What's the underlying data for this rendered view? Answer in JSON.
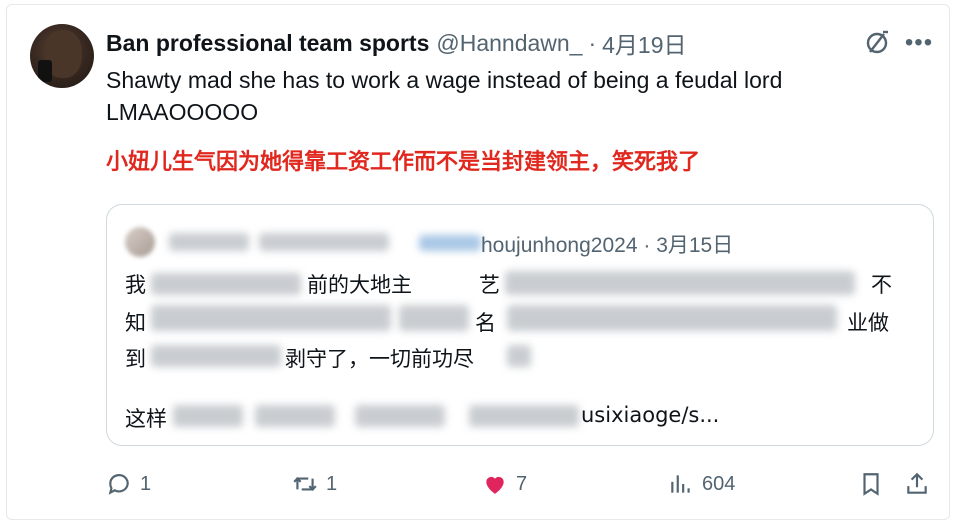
{
  "tweet": {
    "display_name": "Ban professional team sports",
    "handle": "@Hanndawn_",
    "separator": "·",
    "date": "4月19日",
    "text_line1": "Shawty mad she has to work a wage instead of being a feudal lord",
    "text_line2": "LMAAOOOOO",
    "translation": "小妞儿生气因为她得靠工资工作而不是当封建领主，笑死我了",
    "icons": {
      "grok": "grok-icon",
      "more": "more-icon"
    }
  },
  "quote": {
    "handle_visible": "houjunhong2024",
    "separator": "·",
    "date": "3月15日",
    "line1_start": "我",
    "line1_mid": "前的大地主",
    "line1_mid2": "艺",
    "line1_end": "不",
    "line2_start": "知",
    "line2_mid": "名",
    "line2_end": "业做",
    "line3_start": "到",
    "line3_mid": "剥守了，一切前功尽",
    "line4_start": "这样",
    "line4_end": "usixiaoge/s..."
  },
  "actions": {
    "reply_count": "1",
    "retweet_count": "1",
    "like_count": "7",
    "views_count": "604",
    "like_color": "#e0245e",
    "icons": [
      "reply-icon",
      "retweet-icon",
      "heart-icon",
      "views-icon",
      "bookmark-icon",
      "share-icon"
    ]
  }
}
